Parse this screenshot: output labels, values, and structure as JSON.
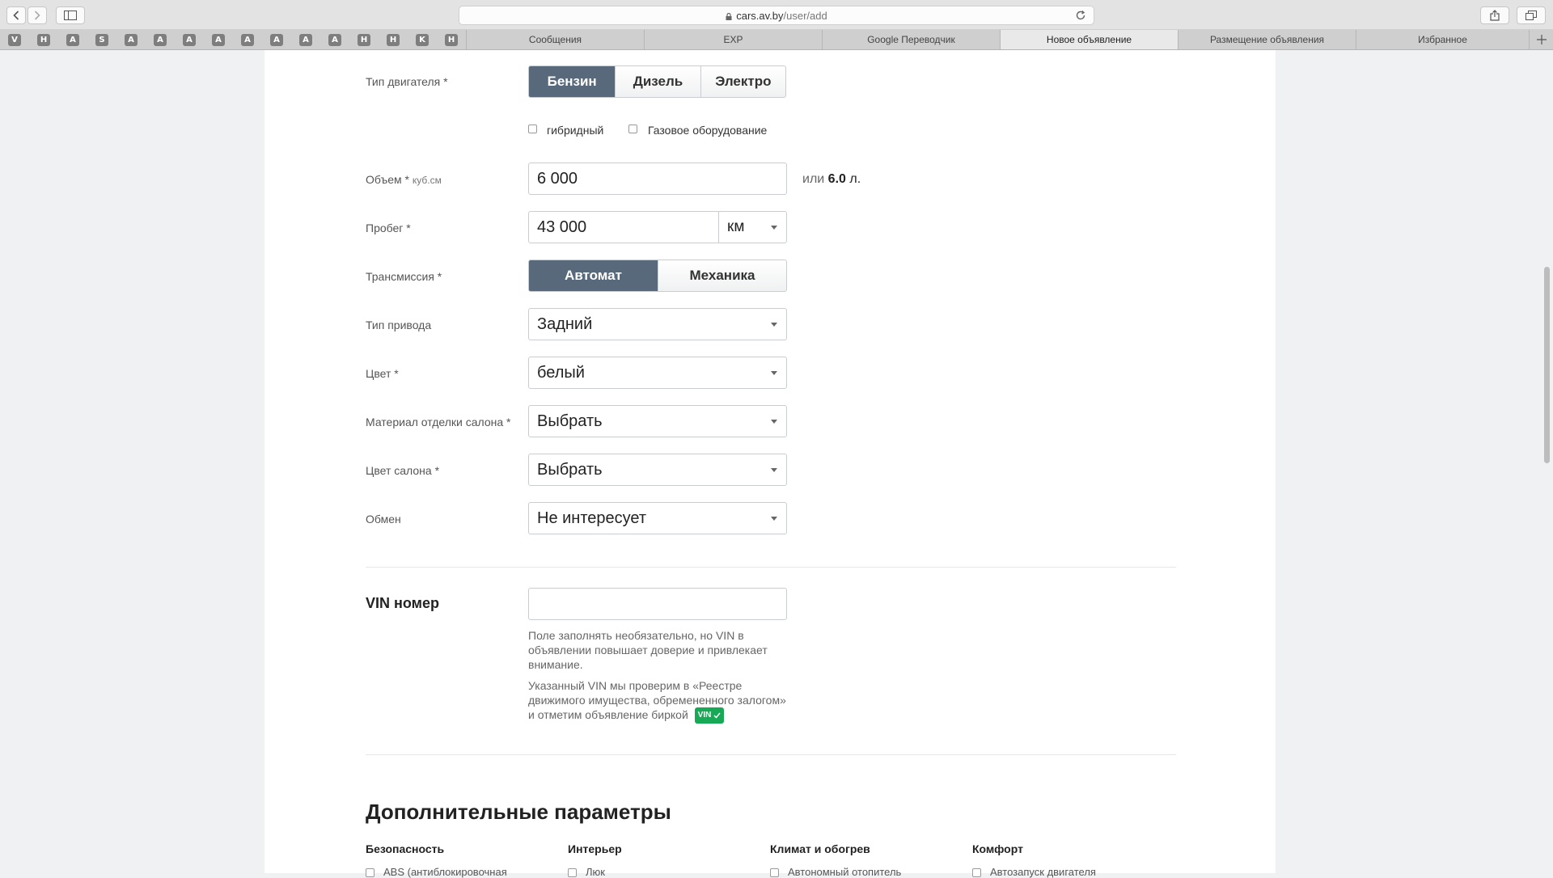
{
  "browser": {
    "url_host": "cars.av.by",
    "url_path": "/user/add",
    "pinned_tabs": [
      "V",
      "H",
      "A",
      "S",
      "A",
      "A",
      "A",
      "A",
      "A",
      "A",
      "A",
      "A",
      "H",
      "H",
      "K",
      "H"
    ],
    "tabs": [
      "Сообщения",
      "EXP",
      "Google Переводчик",
      "Новое объявление",
      "Размещение объявления",
      "Избранное"
    ],
    "active_tab": "Новое объявление"
  },
  "form": {
    "engine": {
      "label": "Тип двигателя *",
      "options": [
        "Бензин",
        "Дизель",
        "Электро"
      ],
      "selected": "Бензин",
      "hybrid_label": "гибридный",
      "gas_label": "Газовое оборудование"
    },
    "volume": {
      "label": "Объем *",
      "unit": "куб.см",
      "value": "6 000",
      "alt_prefix": "или",
      "alt_value": "6.0",
      "alt_suffix": "л."
    },
    "mileage": {
      "label": "Пробег *",
      "value": "43 000",
      "unit": "км"
    },
    "transmission": {
      "label": "Трансмиссия *",
      "options": [
        "Автомат",
        "Механика"
      ],
      "selected": "Автомат"
    },
    "drive": {
      "label": "Тип привода",
      "value": "Задний"
    },
    "color": {
      "label": "Цвет *",
      "value": "белый"
    },
    "interior_material": {
      "label": "Материал отделки салона *",
      "value": "Выбрать"
    },
    "interior_color": {
      "label": "Цвет салона *",
      "value": "Выбрать"
    },
    "exchange": {
      "label": "Обмен",
      "value": "Не интересует"
    },
    "vin": {
      "title": "VIN номер",
      "value": "",
      "hint1": "Поле заполнять необязательно, но VIN в объявлении повышает доверие и привлекает внимание.",
      "hint2": "Указанный VIN мы проверим в «Реестре движимого имущества, обремененного залогом» и отметим объявление биркой",
      "badge": "VIN"
    }
  },
  "extra": {
    "title": "Дополнительные параметры",
    "columns": [
      {
        "heading": "Безопасность",
        "first_item": "ABS (антиблокировочная"
      },
      {
        "heading": "Интерьер",
        "first_item": "Люк"
      },
      {
        "heading": "Климат и обогрев",
        "first_item": "Автономный отопитель"
      },
      {
        "heading": "Комфорт",
        "first_item": "Автозапуск двигателя"
      }
    ]
  },
  "colors": {
    "accent": "#57697a",
    "vin_badge": "#18a957",
    "background": "#eff1f3"
  }
}
